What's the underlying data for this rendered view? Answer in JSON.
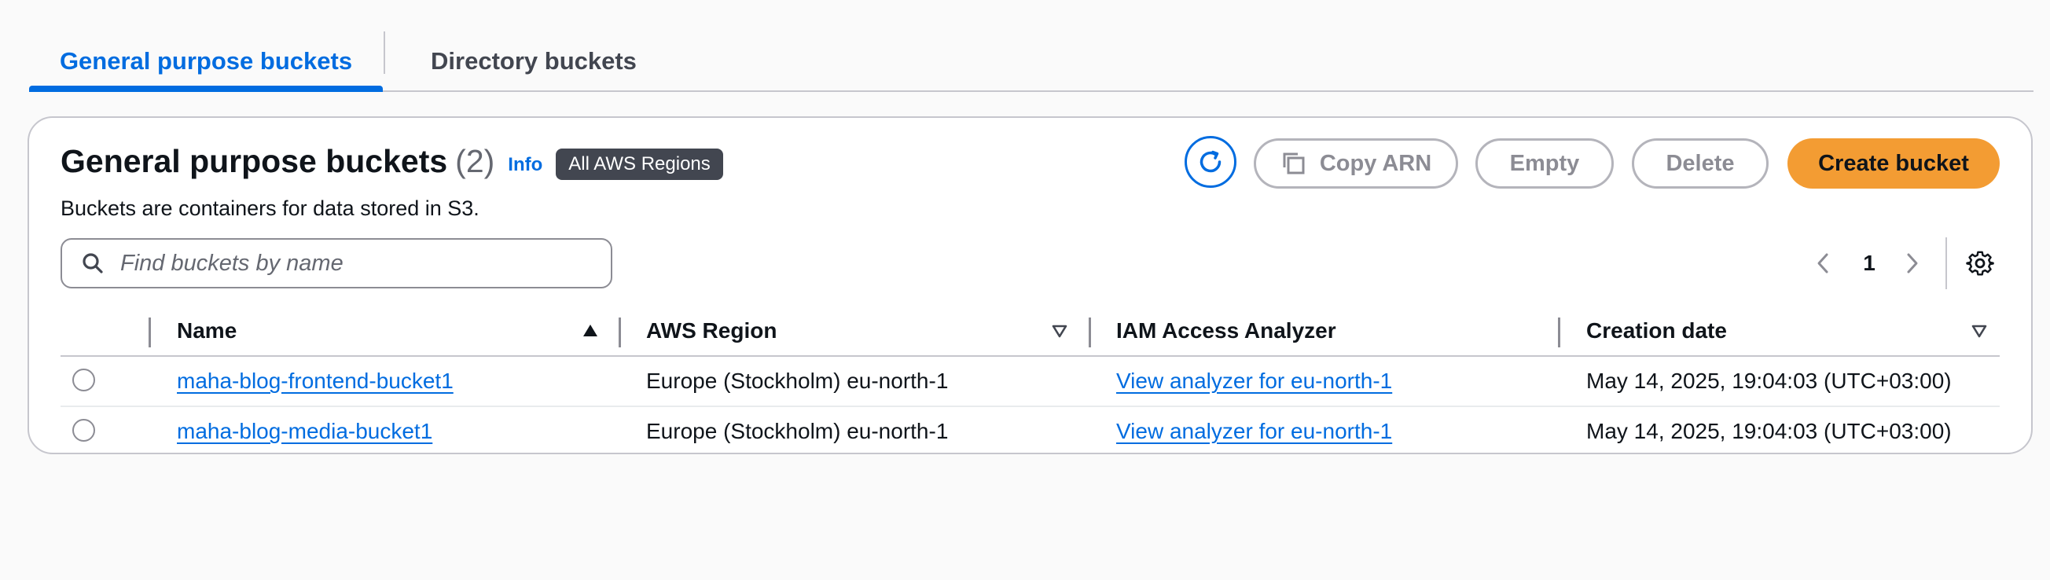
{
  "tabs": {
    "general": "General purpose buckets",
    "directory": "Directory buckets"
  },
  "header": {
    "title": "General purpose buckets",
    "count": "(2)",
    "info": "Info",
    "region_badge": "All AWS Regions",
    "description": "Buckets are containers for data stored in S3."
  },
  "actions": {
    "refresh_icon": "refresh-icon",
    "copy_arn": "Copy ARN",
    "empty": "Empty",
    "delete": "Delete",
    "create": "Create bucket"
  },
  "search": {
    "placeholder": "Find buckets by name",
    "value": ""
  },
  "pagination": {
    "current_page": "1"
  },
  "table": {
    "columns": {
      "name": "Name",
      "region": "AWS Region",
      "iam": "IAM Access Analyzer",
      "created": "Creation date"
    },
    "sort": {
      "column": "Name",
      "direction": "ascending"
    },
    "rows": [
      {
        "name": "maha-blog-frontend-bucket1",
        "region": "Europe (Stockholm) eu-north-1",
        "iam": "View analyzer for eu-north-1",
        "created": "May 14, 2025, 19:04:03 (UTC+03:00)"
      },
      {
        "name": "maha-blog-media-bucket1",
        "region": "Europe (Stockholm) eu-north-1",
        "iam": "View analyzer for eu-north-1",
        "created": "May 14, 2025, 19:04:03 (UTC+03:00)"
      }
    ]
  },
  "colors": {
    "accent": "#006ce0",
    "primary_button": "#f39c33",
    "badge_bg": "#424650"
  }
}
